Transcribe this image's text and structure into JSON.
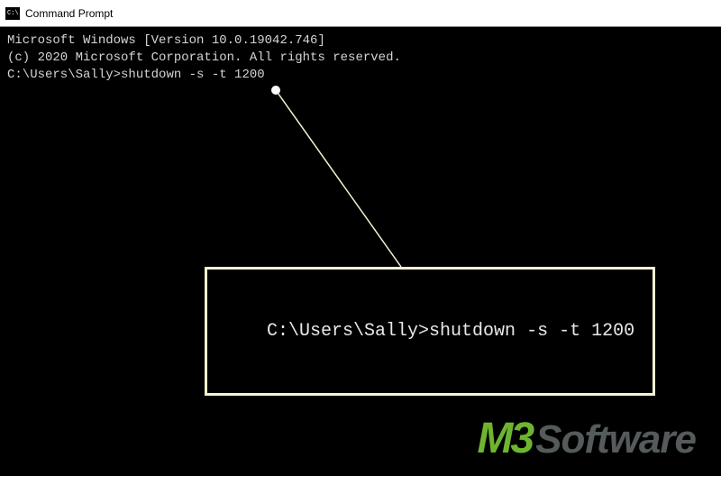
{
  "titlebar": {
    "icon_label": "C:\\.",
    "title": "Command Prompt"
  },
  "terminal": {
    "line1": "Microsoft Windows [Version 10.0.19042.746]",
    "line2": "(c) 2020 Microsoft Corporation. All rights reserved.",
    "blank": "",
    "prompt": "C:\\Users\\Sally>",
    "command": "shutdown -s -t 1200"
  },
  "callout": {
    "text": "C:\\Users\\Sally>shutdown -s -t 1200"
  },
  "watermark": {
    "part1": "M3",
    "part2": "Software"
  }
}
